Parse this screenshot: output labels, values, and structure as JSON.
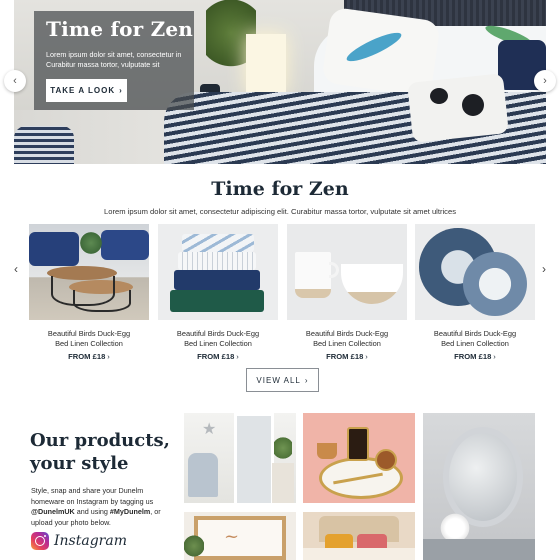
{
  "hero": {
    "title": "Time for Zen",
    "text": "Lorem ipsum dolor sit amet, consectetur in Curabitur massa tortor, vulputate sit",
    "button_label": "TAKE A LOOK",
    "button_chevron": "›",
    "prev_icon": "chevron-left-icon",
    "next_icon": "chevron-right-icon",
    "prev_glyph": "‹",
    "next_glyph": "›"
  },
  "section": {
    "title": "Time for Zen",
    "subtitle": "Lorem ipsum dolor sit amet, consectetur adipiscing elit. Curabitur massa tortor, vulputate sit amet ultrices"
  },
  "carousel": {
    "prev_glyph": "‹",
    "next_glyph": "›",
    "products": [
      {
        "name_line1": "Beautiful Birds Duck-Egg",
        "name_line2": "Bed Linen Collection",
        "price": "FROM £18",
        "image": "nesting-coffee-tables-image"
      },
      {
        "name_line1": "Beautiful Birds Duck-Egg",
        "name_line2": "Bed Linen Collection",
        "price": "FROM £18",
        "image": "folded-towels-image"
      },
      {
        "name_line1": "Beautiful Birds Duck-Egg",
        "name_line2": "Bed Linen Collection",
        "price": "FROM £18",
        "image": "mug-and-bowl-image"
      },
      {
        "name_line1": "Beautiful Birds Duck-Egg",
        "name_line2": "Bed Linen Collection",
        "price": "FROM £18",
        "image": "blue-plates-image"
      }
    ],
    "price_chevron": "›"
  },
  "view_all": {
    "label": "VIEW ALL",
    "chevron": "›"
  },
  "instagram": {
    "title_line1": "Our products,",
    "title_line2": "your style",
    "text_part1": "Style, snap and share your Dunelm homeware on Instagram by tagging us ",
    "handle": "@DunelmUK",
    "text_part2": " and using ",
    "hashtag": "#MyDunelm",
    "text_part3": ", or upload your photo below.",
    "brand_word": "Instagram",
    "icon": "instagram-icon"
  },
  "colors": {
    "navy": "#1d2a36",
    "hero_overlay": "#464b4e",
    "instagram_gradient": [
      "#f9a23a",
      "#e4405f",
      "#b62a94",
      "#5b4fd0"
    ]
  }
}
